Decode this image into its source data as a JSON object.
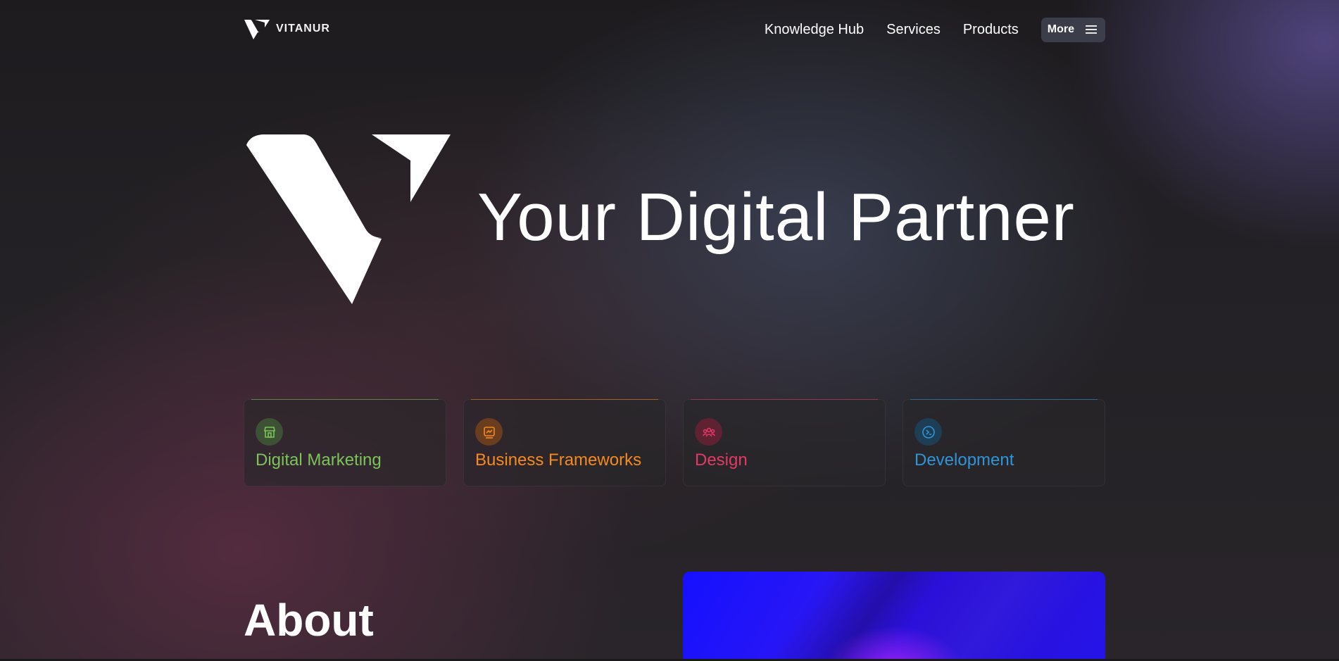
{
  "brand": {
    "name": "VITANUR",
    "logo_icon": "vitanur-v-logo-icon"
  },
  "nav": {
    "links": [
      "Knowledge Hub",
      "Services",
      "Products"
    ],
    "more_label": "More",
    "more_icon": "hamburger-menu-icon"
  },
  "hero": {
    "title": "Your Digital Partner"
  },
  "categories": [
    {
      "label": "Digital Marketing",
      "icon": "storefront-icon",
      "color": "#7cc35a",
      "icon_bg": "#3d5234"
    },
    {
      "label": "Business Frameworks",
      "icon": "monitor-chart-icon",
      "color": "#f58a1f",
      "icon_bg": "#6a3d1e"
    },
    {
      "label": "Design",
      "icon": "users-group-icon",
      "color": "#e23a66",
      "icon_bg": "#5e2232"
    },
    {
      "label": "Development",
      "icon": "terminal-icon",
      "color": "#2f95d9",
      "icon_bg": "#1e3e56"
    }
  ],
  "about": {
    "title": "About"
  }
}
